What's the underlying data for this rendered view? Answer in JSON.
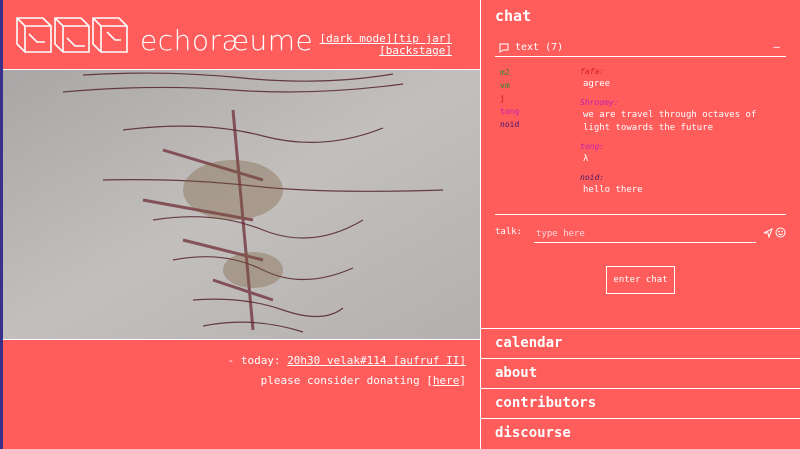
{
  "header": {
    "site_title": "echoræume",
    "links": {
      "dark_mode": "[dark mode]",
      "tip_jar": "[tip jar]",
      "backstage": "[backstage]"
    }
  },
  "schedule": {
    "today_prefix": "- today:",
    "today_link": "20h30 velak#114 [aufruf II]",
    "donate_text": "please consider donating",
    "donate_open": "[",
    "donate_link": "here",
    "donate_close": "]"
  },
  "chat": {
    "title": "chat",
    "tab_label": "text (7)",
    "collapse_glyph": "—",
    "users": [
      {
        "name": "m2",
        "color": "#2f8a2f"
      },
      {
        "name": "vm",
        "color": "#2f8a2f"
      },
      {
        "name": "j",
        "color": "#c21414"
      },
      {
        "name": "tong",
        "color": "#c21fb0"
      },
      {
        "name": "noid",
        "color": "#3a1670"
      }
    ],
    "messages": [
      {
        "author": "fafa:",
        "author_color": "#d4202a",
        "text": "agree"
      },
      {
        "author": "Shroomy:",
        "author_color": "#c21fb0",
        "text": "we are travel through octaves of light towards the future"
      },
      {
        "author": "tong:",
        "author_color": "#c21fb0",
        "text": "λ"
      },
      {
        "author": "noid:",
        "author_color": "#4a1a5e",
        "text": "hello there"
      }
    ],
    "talk_label": "talk:",
    "talk_placeholder": "type here",
    "enter_button": "enter chat"
  },
  "sections": {
    "calendar": "calendar",
    "about": "about",
    "contributors": "contributors",
    "discourse": "discourse"
  },
  "colors": {
    "background": "#ff5c5c",
    "foreground": "#ffffff",
    "edge": "#3a2f8a"
  }
}
